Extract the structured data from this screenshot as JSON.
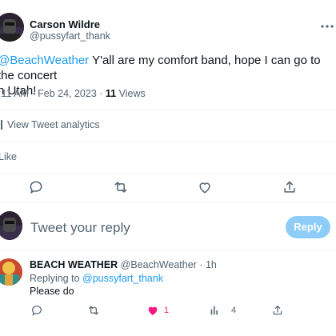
{
  "tweet": {
    "author_name": "Carson Wildre",
    "author_handle": "@pussyfart_thank",
    "mention": "@BeachWeather",
    "text_line1": " Y'all are my comfort band, hope I can go to the concert",
    "text_line2": "n Utah!",
    "time": ":11 AM",
    "date": "Feb 24, 2023",
    "views_count": "11",
    "views_label": "Views",
    "analytics_label": "View Tweet analytics",
    "like_label": "Like"
  },
  "composer": {
    "placeholder": "Tweet your reply",
    "reply_button": "Reply"
  },
  "reply": {
    "author_name": "BEACH WEATHER",
    "author_handle": "@BeachWeather",
    "time": "1h",
    "replying_label": "Replying to",
    "replying_handle": "@pussyfart_thank",
    "text": "Please do",
    "likes": "1",
    "views": "4"
  },
  "colors": {
    "accent": "#1d9bf0",
    "like_pink": "#f91880",
    "muted": "#536471",
    "reply_button_bg": "#8ecdf8"
  },
  "icons": [
    "more-icon",
    "reply-icon",
    "retweet-icon",
    "like-icon",
    "share-icon",
    "analytics-icon",
    "heart-filled-icon"
  ]
}
